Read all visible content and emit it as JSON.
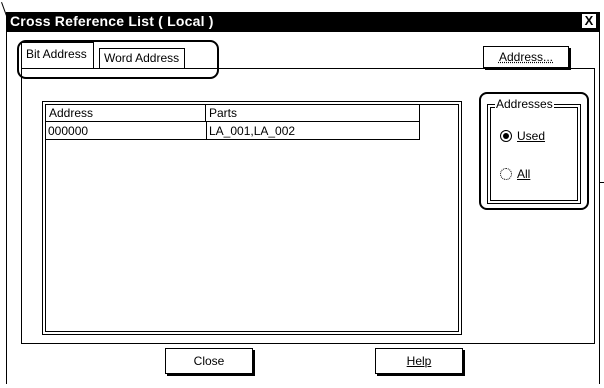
{
  "window": {
    "title": "Cross Reference List ( Local )",
    "close_glyph": "X"
  },
  "tabs": [
    {
      "label": "Bit Address",
      "selected": true
    },
    {
      "label": "Word Address",
      "selected": false
    }
  ],
  "list": {
    "columns": [
      "Address",
      "Parts"
    ],
    "rows": [
      {
        "address": "000000",
        "parts": "LA_001,LA_002"
      }
    ]
  },
  "address_button": {
    "label": "Address..."
  },
  "addresses_group": {
    "label": "Addresses",
    "options": [
      {
        "label": "Used",
        "selected": true
      },
      {
        "label": "All",
        "selected": false
      }
    ]
  },
  "buttons": {
    "close_label": "Close",
    "help_label": "Help"
  }
}
